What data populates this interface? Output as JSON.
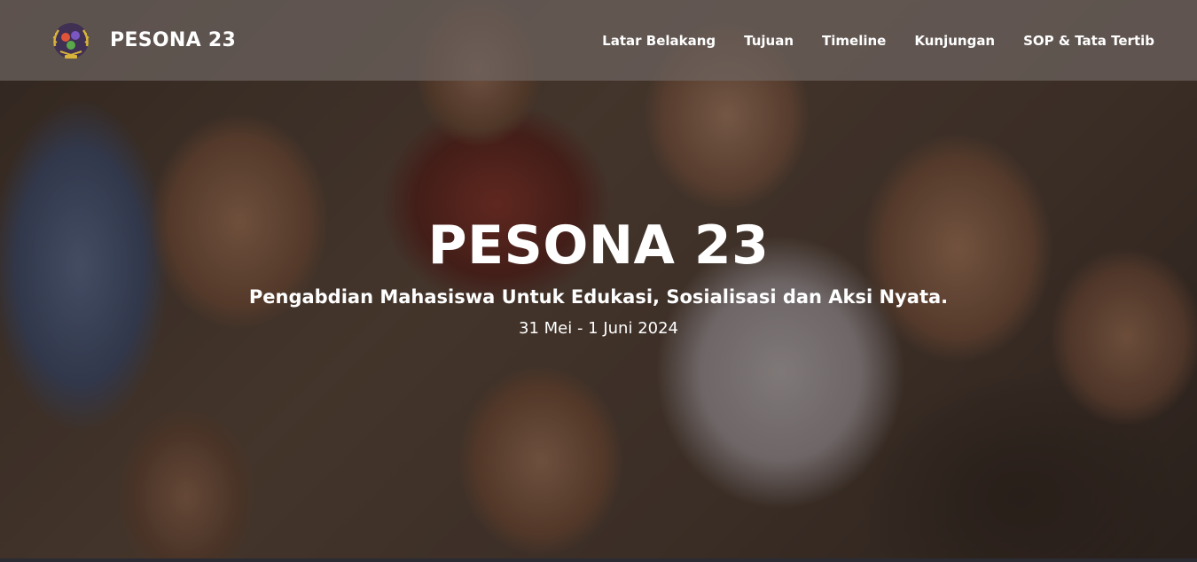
{
  "brand": {
    "name": "PESONA 23",
    "logo_icon": "pesona-emblem-icon"
  },
  "nav": {
    "items": [
      {
        "label": "Latar Belakang"
      },
      {
        "label": "Tujuan"
      },
      {
        "label": "Timeline"
      },
      {
        "label": "Kunjungan"
      },
      {
        "label": "SOP & Tata Tertib"
      }
    ]
  },
  "hero": {
    "title": "PESONA 23",
    "subtitle": "Pengabdian Mahasiswa Untuk Edukasi, Sosialisasi dan Aksi Nyata.",
    "date": "31 Mei - 1 Juni 2024"
  },
  "colors": {
    "navbar_bg": "#6e645f",
    "text": "#ffffff"
  }
}
